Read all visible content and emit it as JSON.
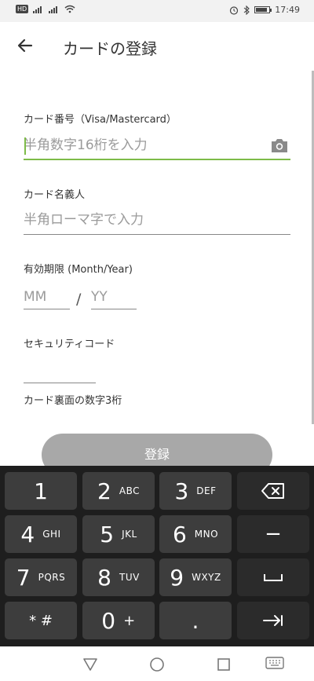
{
  "status_bar": {
    "time": "17:49",
    "hd": "HD",
    "battery_level": 0.85
  },
  "header": {
    "title": "カードの登録"
  },
  "form": {
    "card_number_label": "カード番号（Visa/Mastercard）",
    "card_number_placeholder": "半角数字16桁を入力",
    "card_holder_label": "カード名義人",
    "card_holder_placeholder": "半角ローマ字で入力",
    "expiry_label": "有効期限 (Month/Year)",
    "expiry_month_placeholder": "MM",
    "expiry_separator": "/",
    "expiry_year_placeholder": "YY",
    "security_label": "セキュリティコード",
    "security_hint": "カード裏面の数字3桁",
    "submit_label": "登録"
  },
  "keyboard": {
    "rows": [
      [
        {
          "main": "1",
          "sub": ""
        },
        {
          "main": "2",
          "sub": "ABC"
        },
        {
          "main": "3",
          "sub": "DEF"
        }
      ],
      [
        {
          "main": "4",
          "sub": "GHI"
        },
        {
          "main": "5",
          "sub": "JKL"
        },
        {
          "main": "6",
          "sub": "MNO"
        }
      ],
      [
        {
          "main": "7",
          "sub": "PQRS"
        },
        {
          "main": "8",
          "sub": "TUV"
        },
        {
          "main": "9",
          "sub": "WXYZ"
        }
      ],
      [
        {
          "main": "* #",
          "sub": ""
        },
        {
          "main": "0",
          "sub": "+"
        },
        {
          "main": ".",
          "sub": ""
        }
      ]
    ],
    "side_keys": [
      "backspace-icon",
      "minus",
      "space-icon",
      "tab-icon"
    ]
  },
  "nav": {
    "icons": [
      "back-triangle-icon",
      "home-circle-icon",
      "recents-square-icon",
      "keyboard-icon"
    ]
  },
  "colors": {
    "accent": "#7dbb48",
    "button_disabled": "#a8a8a8",
    "keyboard_bg": "#1e1e1e",
    "key_bg": "#3d3d3d"
  }
}
